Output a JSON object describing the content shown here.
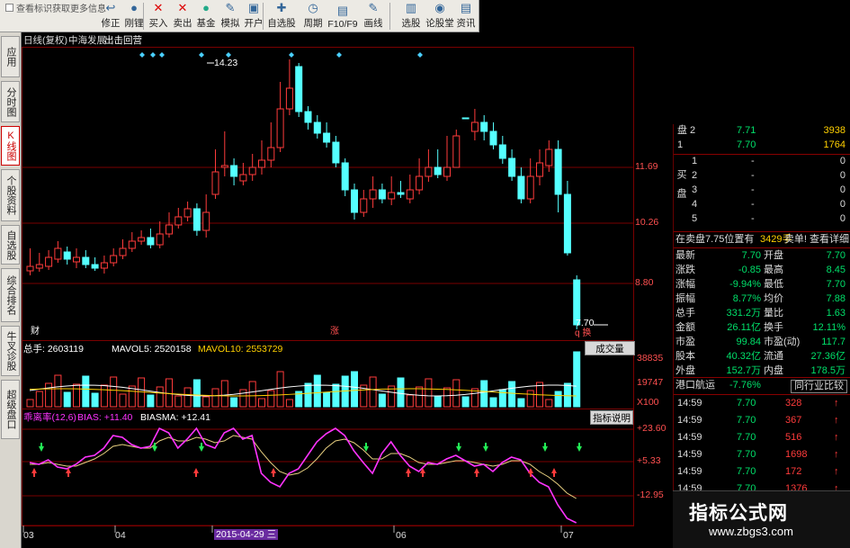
{
  "toolbar": {
    "search_text": "查看标识获取更多信息",
    "buttons": [
      {
        "label": "修正",
        "icon": "↩"
      },
      {
        "label": "刚锂",
        "icon": "●"
      },
      {
        "label": "买入",
        "icon": "✕"
      },
      {
        "label": "卖出",
        "icon": "✕"
      },
      {
        "label": "基金",
        "icon": "●"
      },
      {
        "label": "模拟",
        "icon": "✎"
      },
      {
        "label": "开户",
        "icon": "▣"
      },
      {
        "label": "自选股",
        "icon": "✚"
      },
      {
        "label": "周期",
        "icon": "◷"
      },
      {
        "label": "F10/F9",
        "icon": "▤"
      },
      {
        "label": "画线",
        "icon": "✎"
      },
      {
        "label": "选股",
        "icon": "▥"
      },
      {
        "label": "论股堂",
        "icon": "◉"
      },
      {
        "label": "资讯",
        "icon": "▤"
      }
    ]
  },
  "vtabs": [
    {
      "label": "应用",
      "active": false
    },
    {
      "label": "分时图",
      "active": false
    },
    {
      "label": "K线图",
      "active": true
    },
    {
      "label": "个股资料",
      "active": false
    },
    {
      "label": "自选股",
      "active": false
    },
    {
      "label": "综合排名",
      "active": false
    },
    {
      "label": "牛叉诊股",
      "active": false
    },
    {
      "label": "超级盘口",
      "active": false
    }
  ],
  "chart": {
    "header": "日线(复权)",
    "name": "中海发展",
    "signal": "出击回营",
    "high_label": "14.23",
    "low_label": "7.70",
    "price_axis": [
      "11.69",
      "10.26",
      "8.80"
    ],
    "marker_cai": "财",
    "marker_zhang": "涨",
    "marker_qbian": "q 换",
    "volume_line": {
      "total": "总手: 2603119",
      "ma5": "MAVOL5: 2520158",
      "ma10": "MAVOL10: 2553729"
    },
    "volume_button": "成交量",
    "volume_axis": [
      "38835",
      "19747",
      "X100"
    ],
    "bias_line": {
      "name": "乖离率(12,6)",
      "bias": "BIAS: +11.40",
      "biasma": "BIASMA: +12.41"
    },
    "bias_button": "指标说明",
    "bias_axis": [
      "+23.60",
      "+5.33",
      "-12.95"
    ],
    "date_axis": [
      "03",
      "04",
      "2015-04-29 三",
      "06",
      "07"
    ],
    "colors": {
      "up": "#ff3b3b",
      "down": "#55ffff",
      "grid": "#7a0000",
      "ma5": "#ffffff",
      "ma10": "#ffd000",
      "bias": "#ff33ff",
      "biasma": "#e8d080"
    }
  },
  "rpanel": {
    "ask_rows": [
      {
        "label": "盘 2",
        "price": "7.71",
        "vol": "3938"
      },
      {
        "label": "1",
        "price": "7.70",
        "vol": "1764"
      }
    ],
    "bid_label": "买盘",
    "bid_rows": [
      {
        "n": "1",
        "price": "-",
        "vol": "0"
      },
      {
        "n": "2",
        "price": "-",
        "vol": "0"
      },
      {
        "n": "3",
        "price": "-",
        "vol": "0"
      },
      {
        "n": "4",
        "price": "-",
        "vol": "0"
      },
      {
        "n": "5",
        "price": "-",
        "vol": "0"
      }
    ],
    "status": {
      "left": "在卖盘7.75位置有",
      "mid": "3429手",
      "right": "卖单! 查看详细"
    },
    "stats": [
      {
        "l1": "最新",
        "v1": "7.70",
        "l2": "开盘",
        "v2": "7.70"
      },
      {
        "l1": "涨跌",
        "v1": "-0.85",
        "l2": "最高",
        "v2": "8.45"
      },
      {
        "l1": "涨幅",
        "v1": "-9.94%",
        "l2": "最低",
        "v2": "7.70"
      },
      {
        "l1": "振幅",
        "v1": "8.77%",
        "l2": "均价",
        "v2": "7.88"
      },
      {
        "l1": "总手",
        "v1": "331.2万",
        "l2": "量比",
        "v2": "1.63"
      },
      {
        "l1": "金额",
        "v1": "26.11亿",
        "l2": "换手",
        "v2": "12.11%"
      },
      {
        "l1": "市盈",
        "v1": "99.84",
        "l2": "市盈(动)",
        "v2": "117.7"
      },
      {
        "l1": "股本",
        "v1": "40.32亿",
        "l2": "流通",
        "v2": "27.36亿"
      },
      {
        "l1": "外盘",
        "v1": "152.7万",
        "l2": "内盘",
        "v2": "178.5万"
      }
    ],
    "sector": {
      "name": "港口航运",
      "change": "-7.76%",
      "button": "同行业比较"
    },
    "ticks": [
      {
        "time": "14:59",
        "price": "7.70",
        "vol": "328"
      },
      {
        "time": "14:59",
        "price": "7.70",
        "vol": "367"
      },
      {
        "time": "14:59",
        "price": "7.70",
        "vol": "516"
      },
      {
        "time": "14:59",
        "price": "7.70",
        "vol": "1698"
      },
      {
        "time": "14:59",
        "price": "7.70",
        "vol": "172"
      },
      {
        "time": "14:59",
        "price": "7.70",
        "vol": "1376"
      },
      {
        "time": "14:59",
        "price": "7.70",
        "vol": ""
      }
    ]
  },
  "watermark": {
    "line1": "指标公式网",
    "line2": "www.zbgs3.com"
  }
}
